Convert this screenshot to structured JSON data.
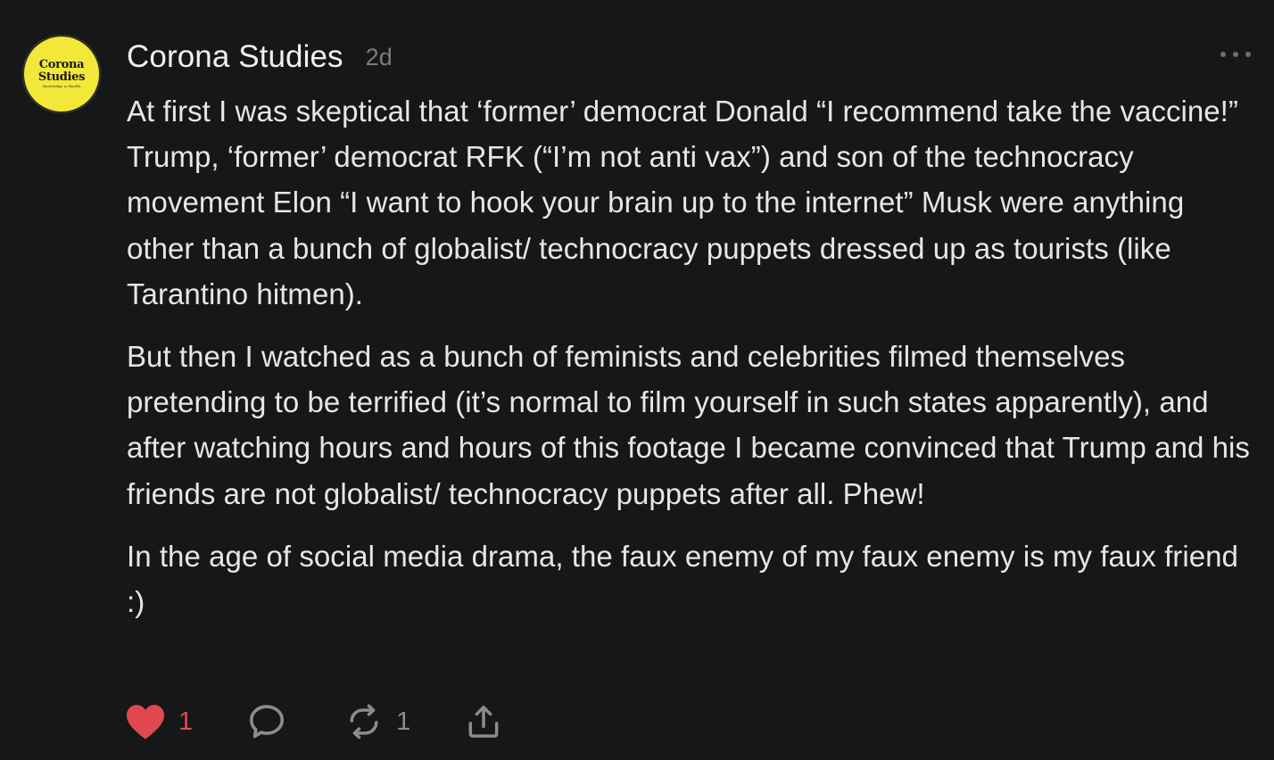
{
  "post": {
    "author_name": "Corona Studies",
    "timestamp": "2d",
    "avatar": {
      "line1": "Corona",
      "line2": "Studies",
      "tagline": "Knowledge is Health",
      "background": "#f3e83a"
    },
    "paragraphs": [
      "At first I was skeptical that ‘former’ democrat Donald “I recommend take the vaccine!” Trump, ‘former’ democrat RFK (“I’m not anti vax”) and son of the technocracy movement Elon “I want to hook your brain up to the internet” Musk were anything other than a bunch of globalist/ technocracy puppets dressed up as tourists (like Tarantino hitmen).",
      "But then I watched as a bunch of feminists and celebrities filmed themselves pretending to be terrified (it’s normal to film yourself in such states apparently), and after watching hours and hours of this footage I became convinced that Trump and his friends are not globalist/ technocracy puppets after all. Phew!",
      "In the age of social media drama, the faux enemy of my faux enemy is my faux friend :)"
    ]
  },
  "actions": {
    "like": {
      "icon": "heart-icon",
      "count": "1",
      "color": "#e2484f",
      "liked": true
    },
    "comment": {
      "icon": "comment-bubble-icon"
    },
    "restack": {
      "icon": "restack-icon",
      "count": "1"
    },
    "share": {
      "icon": "share-icon"
    }
  },
  "menu": {
    "icon": "more-options-icon"
  },
  "theme": {
    "background": "#161718",
    "text": "#e6e6e7",
    "muted": "#7c7d80",
    "accent": "#e2484f"
  }
}
